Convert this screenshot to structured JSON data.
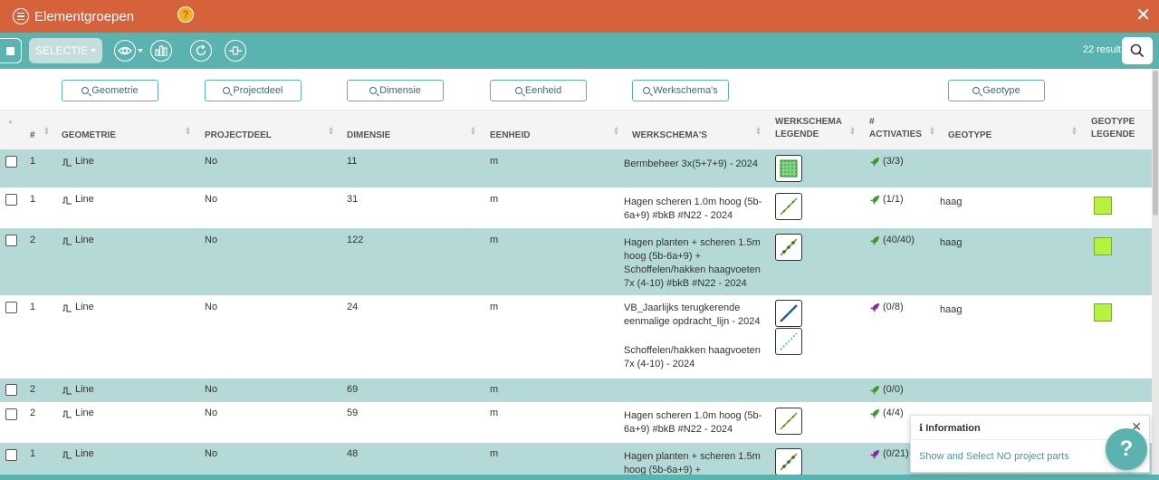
{
  "window": {
    "title": "Elementgroepen"
  },
  "toolbar": {
    "select_label": "SELECTIE",
    "results": "22 result"
  },
  "filters": [
    {
      "label": "Geometrie"
    },
    {
      "label": "Projectdeel"
    },
    {
      "label": "Dimensie"
    },
    {
      "label": "Eenheid"
    },
    {
      "label": "Werkschema's"
    },
    {
      "label": "Geotype"
    }
  ],
  "headers": {
    "num": "#",
    "geometrie": "GEOMETRIE",
    "projectdeel": "PROJECTDEEL",
    "dimensie": "DIMENSIE",
    "eenheid": "EENHEID",
    "werkschemas": "WERKSCHEMA'S",
    "ws_legende_1": "WERKSCHEMA",
    "ws_legende_2": "LEGENDE",
    "activaties_1": "#",
    "activaties_2": "ACTIVATIES",
    "geotype": "GEOTYPE",
    "geo_legende_1": "GEOTYPE",
    "geo_legende_2": "LEGENDE"
  },
  "rows": [
    {
      "num": "1",
      "geometrie": "Line",
      "projectdeel": "No",
      "dimensie": "11",
      "eenheid": "m",
      "werkschemas": [
        "Bermbeheer 3x(5+7+9) - 2024"
      ],
      "activaties": "(3/3)",
      "geotype": ""
    },
    {
      "num": "1",
      "geometrie": "Line",
      "projectdeel": "No",
      "dimensie": "31",
      "eenheid": "m",
      "werkschemas": [
        "Hagen scheren 1.0m hoog (5b-6a+9) #bkB #N22 - 2024"
      ],
      "activaties": "(1/1)",
      "geotype": "haag"
    },
    {
      "num": "2",
      "geometrie": "Line",
      "projectdeel": "No",
      "dimensie": "122",
      "eenheid": "m",
      "werkschemas": [
        "Hagen planten + scheren 1.5m hoog (5b-6a+9) + Schoffelen/hakken haagvoeten 7x (4-10) #bkB #N22 - 2024"
      ],
      "activaties": "(40/40)",
      "geotype": "haag"
    },
    {
      "num": "1",
      "geometrie": "Line",
      "projectdeel": "No",
      "dimensie": "24",
      "eenheid": "m",
      "werkschemas": [
        "VB_Jaarlijks terugkerende eenmalige opdracht_lijn - 2024",
        "Schoffelen/hakken haagvoeten 7x (4-10) - 2024"
      ],
      "activaties": "(0/8)",
      "geotype": "haag"
    },
    {
      "num": "2",
      "geometrie": "Line",
      "projectdeel": "No",
      "dimensie": "69",
      "eenheid": "m",
      "werkschemas": [],
      "activaties": "(0/0)",
      "geotype": ""
    },
    {
      "num": "2",
      "geometrie": "Line",
      "projectdeel": "No",
      "dimensie": "59",
      "eenheid": "m",
      "werkschemas": [
        "Hagen scheren 1.0m hoog (5b-6a+9) #bkB #N22 - 2024"
      ],
      "activaties": "(4/4)",
      "geotype": ""
    },
    {
      "num": "1",
      "geometrie": "Line",
      "projectdeel": "No",
      "dimensie": "48",
      "eenheid": "m",
      "werkschemas": [
        "Hagen planten + scheren 1.5m hoog (5b-6a+9) +"
      ],
      "activaties": "(0/21)",
      "geotype": ""
    }
  ],
  "info_popup": {
    "title": "Information",
    "body": "Show and Select NO project parts"
  },
  "icons": {
    "menu": "list-circle-icon",
    "help": "question-circle-icon",
    "close": "close-icon",
    "eye": "eye-icon",
    "chart": "bar-chart-icon",
    "refresh": "refresh-icon",
    "slider": "slider-icon",
    "search": "search-icon",
    "geometry": "line-geometry-icon",
    "rocket": "rocket-icon"
  },
  "colors": {
    "titlebar": "#d5623b",
    "toolbar": "#5bb3b0",
    "row_teal": "#b4d9d6",
    "rocket_green": "#3a9a2a",
    "rocket_purple": "#8a2a9a",
    "geotype_swatch": "#b5f33c"
  }
}
